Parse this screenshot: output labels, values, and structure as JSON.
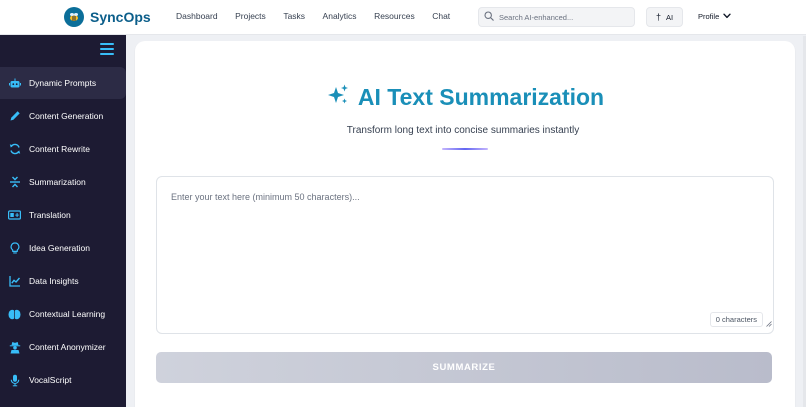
{
  "brand": {
    "name": "SyncOps",
    "logo_icon": "bee-icon"
  },
  "nav": [
    {
      "label": "Dashboard"
    },
    {
      "label": "Projects"
    },
    {
      "label": "Tasks"
    },
    {
      "label": "Analytics"
    },
    {
      "label": "Resources"
    },
    {
      "label": "Chat"
    }
  ],
  "search": {
    "placeholder": "Search AI-enhanced...",
    "value": ""
  },
  "ai_button": {
    "label": "AI",
    "icon": "dagger-icon"
  },
  "profile": {
    "label": "Profile",
    "icon": "chevron-down-icon"
  },
  "sidebar": {
    "accent": "#38bdf8",
    "items": [
      {
        "label": "Dynamic Prompts",
        "icon": "robot-icon",
        "active": true
      },
      {
        "label": "Content Generation",
        "icon": "pencil-icon"
      },
      {
        "label": "Content Rewrite",
        "icon": "refresh-icon"
      },
      {
        "label": "Summarization",
        "icon": "compress-icon"
      },
      {
        "label": "Translation",
        "icon": "language-icon"
      },
      {
        "label": "Idea Generation",
        "icon": "lightbulb-icon"
      },
      {
        "label": "Data Insights",
        "icon": "chart-line-icon"
      },
      {
        "label": "Contextual Learning",
        "icon": "brain-icon"
      },
      {
        "label": "Content Anonymizer",
        "icon": "user-secret-icon"
      },
      {
        "label": "VocalScript",
        "icon": "microphone-icon"
      }
    ]
  },
  "main": {
    "title": "AI Text Summarization",
    "title_icon": "sparkles-icon",
    "subtitle": "Transform long text into concise summaries instantly",
    "textarea": {
      "placeholder": "Enter your text here (minimum 50 characters)...",
      "value": ""
    },
    "char_count": "0 characters",
    "summarize_label": "SUMMARIZE"
  },
  "colors": {
    "title": "#1a8fb8",
    "sidebar_bg": "#1d1b33",
    "brand": "#0b5e8a"
  }
}
